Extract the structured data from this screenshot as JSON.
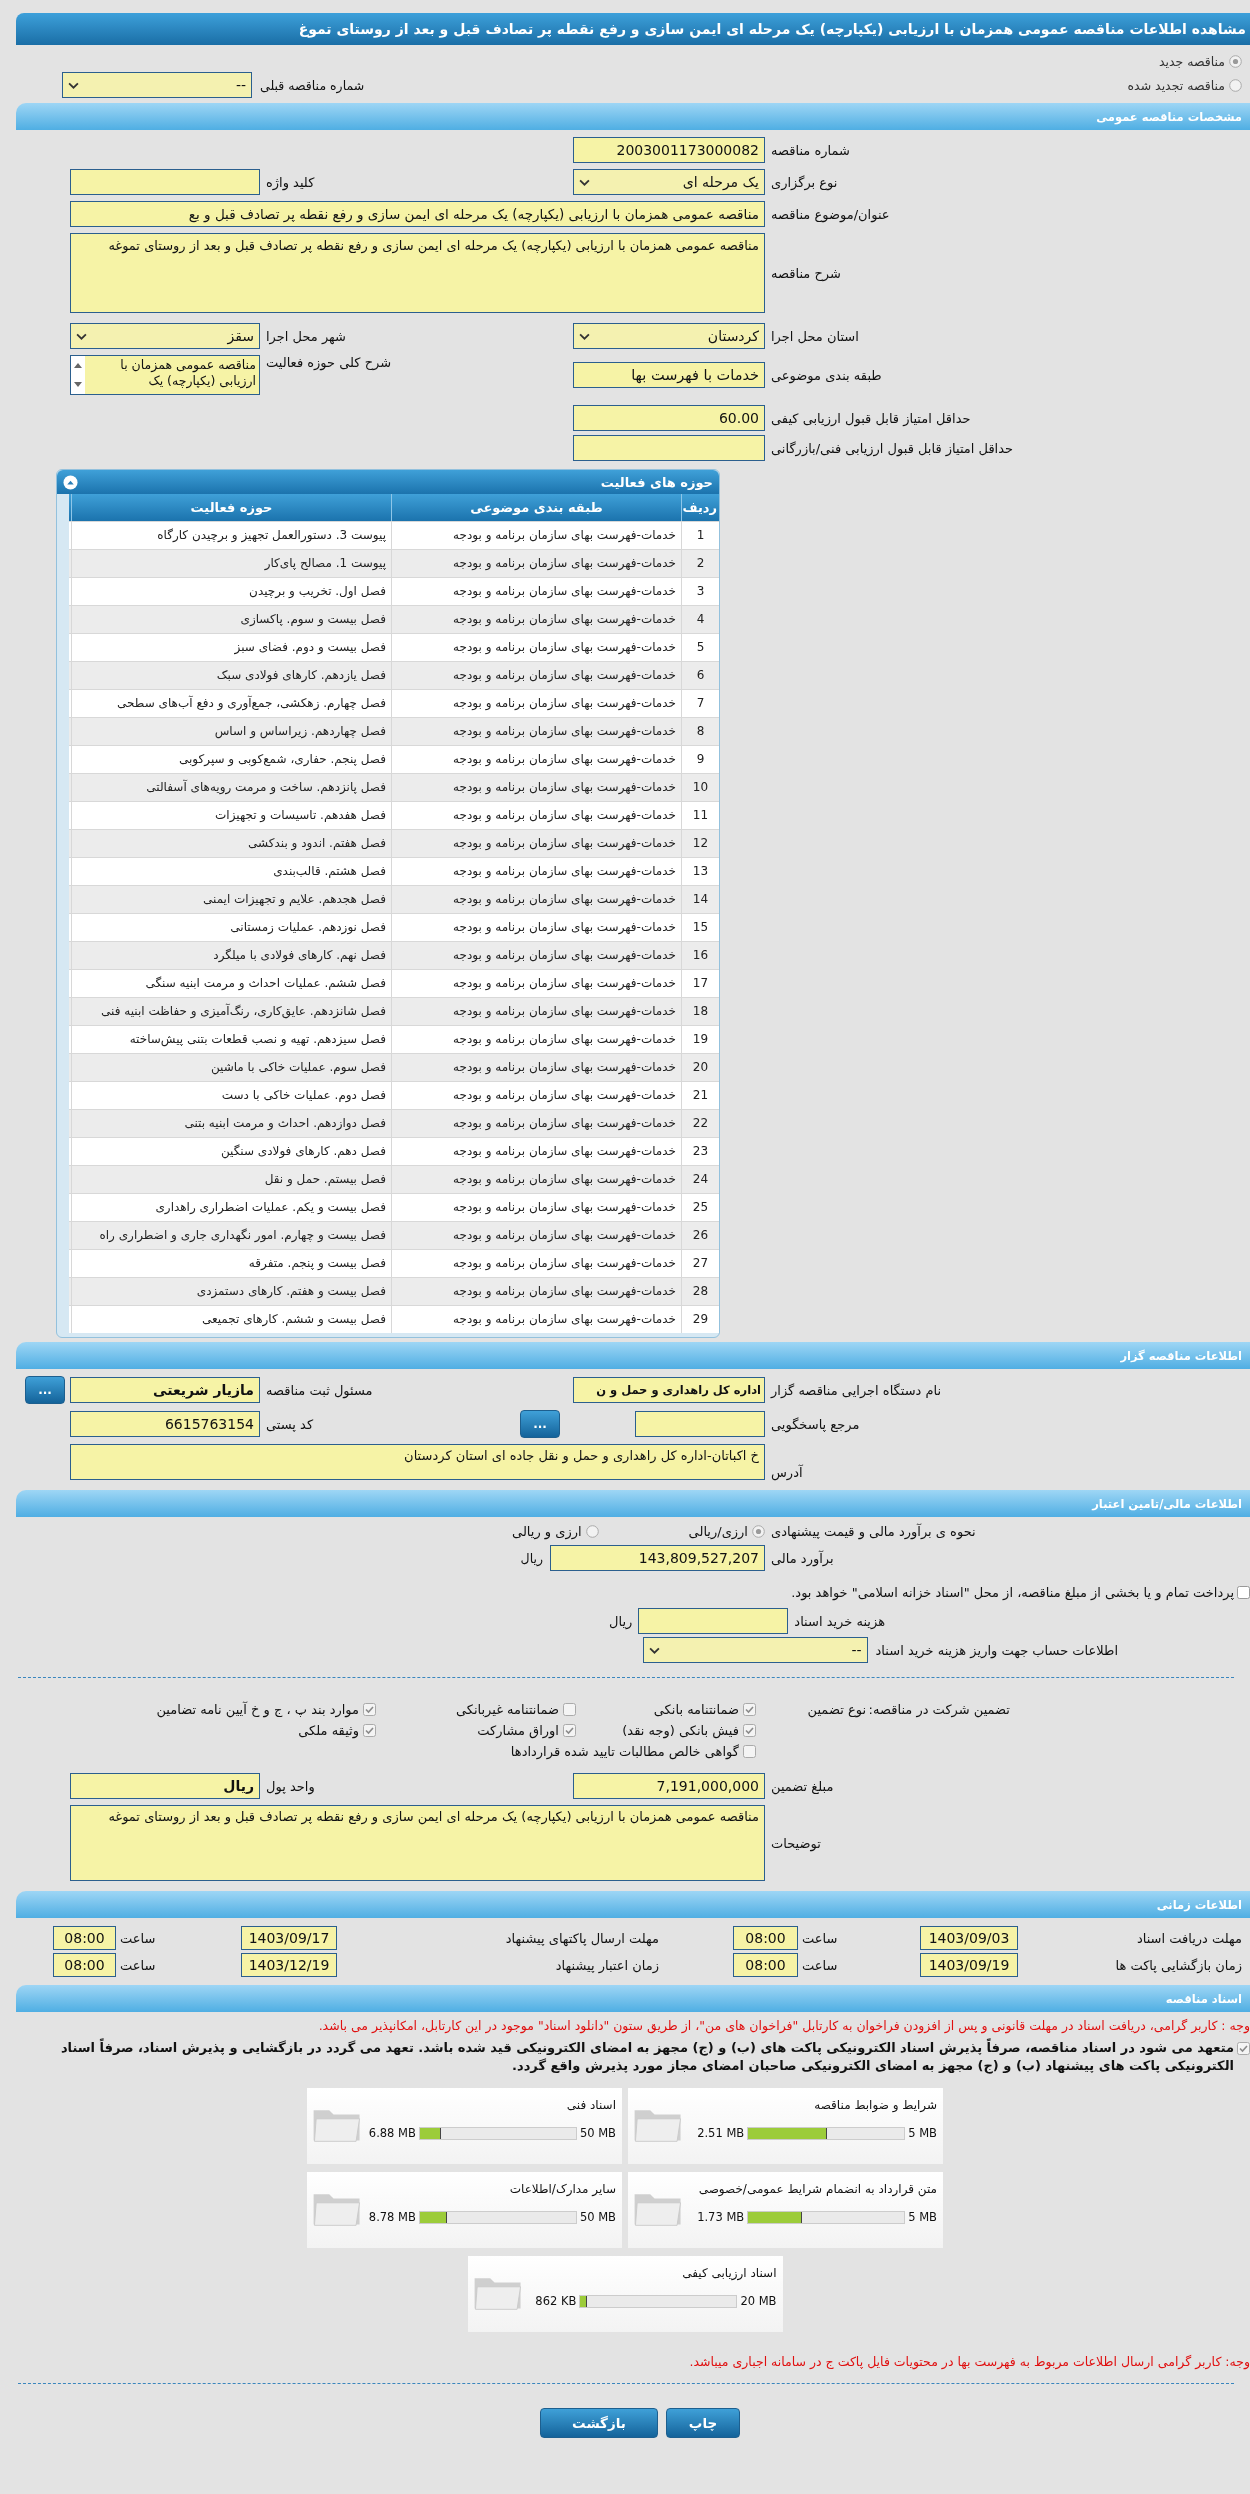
{
  "title": "مشاهده اطلاعات مناقصه عمومی همزمان با ارزیابی (یکپارچه) یک مرحله ای ایمن سازی و رفع نقطه پر تصادف قبل و بعد از روستای تموغ",
  "tender_kind": [
    {
      "label": "مناقصه جدید",
      "selected": true
    },
    {
      "label": "مناقصه تجدید شده",
      "selected": false
    }
  ],
  "previous_tender": {
    "label": "شماره مناقصه قبلی",
    "value": "--"
  },
  "general": {
    "header": "مشخصات مناقصه عمومی",
    "tender_number": {
      "label": "شماره مناقصه",
      "value": "2003001173000082"
    },
    "holding_type": {
      "label": "نوع برگزاری",
      "value": "یک مرحله ای"
    },
    "keyword": {
      "label": "کلید واژه"
    },
    "subject": {
      "label": "عنوان/موضوع مناقصه",
      "value": "مناقصه عمومی همزمان با ارزیابی (یکپارچه) یک مرحله ای  ایمن سازی و رفع نقطه پر تصادف قبل و بع"
    },
    "description": {
      "label": "شرح مناقصه",
      "value": "مناقصه عمومی همزمان با ارزیابی (یکپارچه) یک مرحله ای ایمن سازی و رفع نقطه پر تصادف قبل و بعد از روستای تموغه"
    },
    "province": {
      "label": "استان محل اجرا",
      "value": "کردستان"
    },
    "city": {
      "label": "شهر محل اجرا",
      "value": "سقز"
    },
    "classification": {
      "label": "طبقه بندی موضوعی",
      "value": "خدمات با فهرست بها"
    },
    "activity_summary": {
      "label": "شرح کلی حوزه فعالیت",
      "value": "مناقصه عمومی همزمان با ارزیابی (یکپارچه) یک"
    },
    "min_quality_score": {
      "label": "حداقل امتیاز قابل قبول ارزیابی کیفی",
      "value": "60.00"
    },
    "min_technical_score": {
      "label": "حداقل امتیاز قابل قبول ارزیابی فنی/بازرگانی"
    }
  },
  "activities": {
    "title": "حوزه های فعالیت",
    "columns": [
      "ردیف",
      "طبقه بندی موضوعی",
      "حوزه فعالیت"
    ],
    "rows": [
      {
        "no": "1",
        "category": "خدمات-فهرست بهای سازمان برنامه و بودجه",
        "activity": "پیوست 3. دستورالعمل تجهیز و برچیدن کارگاه"
      },
      {
        "no": "2",
        "category": "خدمات-فهرست بهای سازمان برنامه و بودجه",
        "activity": "پیوست 1. مصالح پای‌کار"
      },
      {
        "no": "3",
        "category": "خدمات-فهرست بهای سازمان برنامه و بودجه",
        "activity": "فصل اول. تخریب و برچیدن"
      },
      {
        "no": "4",
        "category": "خدمات-فهرست بهای سازمان برنامه و بودجه",
        "activity": "فصل بیست و سوم. پاکسازی"
      },
      {
        "no": "5",
        "category": "خدمات-فهرست بهای سازمان برنامه و بودجه",
        "activity": "فصل بیست و دوم. فضای سبز"
      },
      {
        "no": "6",
        "category": "خدمات-فهرست بهای سازمان برنامه و بودجه",
        "activity": "فصل یازدهم. کارهای فولادی سبک"
      },
      {
        "no": "7",
        "category": "خدمات-فهرست بهای سازمان برنامه و بودجه",
        "activity": "فصل چهارم. زهکشی، جمع‌آوری و دفع آب‌های سطحی"
      },
      {
        "no": "8",
        "category": "خدمات-فهرست بهای سازمان برنامه و بودجه",
        "activity": "فصل چهاردهم. زیراساس و اساس"
      },
      {
        "no": "9",
        "category": "خدمات-فهرست بهای سازمان برنامه و بودجه",
        "activity": "فصل پنجم. حفاری، شمع‌کوبی و سپرکوبی"
      },
      {
        "no": "10",
        "category": "خدمات-فهرست بهای سازمان برنامه و بودجه",
        "activity": "فصل پانزدهم. ساخت و مرمت رویه‌های آسفالتی"
      },
      {
        "no": "11",
        "category": "خدمات-فهرست بهای سازمان برنامه و بودجه",
        "activity": "فصل هفدهم. تاسیسات و تجهیزات"
      },
      {
        "no": "12",
        "category": "خدمات-فهرست بهای سازمان برنامه و بودجه",
        "activity": "فصل هفتم. اندود و بندکشی"
      },
      {
        "no": "13",
        "category": "خدمات-فهرست بهای سازمان برنامه و بودجه",
        "activity": "فصل هشتم. قالب‌بندی"
      },
      {
        "no": "14",
        "category": "خدمات-فهرست بهای سازمان برنامه و بودجه",
        "activity": "فصل هجدهم. علایم و تجهیزات ایمنی"
      },
      {
        "no": "15",
        "category": "خدمات-فهرست بهای سازمان برنامه و بودجه",
        "activity": "فصل نوزدهم. عملیات زمستانی"
      },
      {
        "no": "16",
        "category": "خدمات-فهرست بهای سازمان برنامه و بودجه",
        "activity": "فصل نهم. کارهای فولادی با میلگرد"
      },
      {
        "no": "17",
        "category": "خدمات-فهرست بهای سازمان برنامه و بودجه",
        "activity": "فصل ششم.  عملیات احداث و مرمت ابنیه سنگی"
      },
      {
        "no": "18",
        "category": "خدمات-فهرست بهای سازمان برنامه و بودجه",
        "activity": "فصل شانزدهم. عایق‌کاری، رنگ‌آمیزی و حفاظت ابنیه فنی"
      },
      {
        "no": "19",
        "category": "خدمات-فهرست بهای سازمان برنامه و بودجه",
        "activity": "فصل سیزدهم. تهیه و نصب قطعات بتنی پیش‌ساخته"
      },
      {
        "no": "20",
        "category": "خدمات-فهرست بهای سازمان برنامه و بودجه",
        "activity": "فصل سوم. عملیات خاکی با ماشین"
      },
      {
        "no": "21",
        "category": "خدمات-فهرست بهای سازمان برنامه و بودجه",
        "activity": "فصل دوم. عملیات خاکی با دست"
      },
      {
        "no": "22",
        "category": "خدمات-فهرست بهای سازمان برنامه و بودجه",
        "activity": "فصل دوازدهم. احداث و مرمت ابنیه بتنی"
      },
      {
        "no": "23",
        "category": "خدمات-فهرست بهای سازمان برنامه و بودجه",
        "activity": "فصل دهم. کارهای فولادی سنگین"
      },
      {
        "no": "24",
        "category": "خدمات-فهرست بهای سازمان برنامه و بودجه",
        "activity": "فصل بیستم. حمل و نقل"
      },
      {
        "no": "25",
        "category": "خدمات-فهرست بهای سازمان برنامه و بودجه",
        "activity": "فصل بیست و یکم. عملیات اضطراری راهداری"
      },
      {
        "no": "26",
        "category": "خدمات-فهرست بهای سازمان برنامه و بودجه",
        "activity": "فصل بیست و چهارم. امور نگهداری جاری و اضطراری راه"
      },
      {
        "no": "27",
        "category": "خدمات-فهرست بهای سازمان برنامه و بودجه",
        "activity": "فصل بیست و پنجم. متفرقه"
      },
      {
        "no": "28",
        "category": "خدمات-فهرست بهای سازمان برنامه و بودجه",
        "activity": "فصل بیست و هفتم. کارهای دستمزدی"
      },
      {
        "no": "29",
        "category": "خدمات-فهرست بهای سازمان برنامه و بودجه",
        "activity": "فصل بیست و ششم. کارهای تجمیعی"
      }
    ]
  },
  "organizer": {
    "header": "اطلاعات مناقصه گزار",
    "agency": {
      "label": "نام دستگاه اجرایی مناقصه گزار",
      "value": "اداره کل راهداری و حمل و ن"
    },
    "registrar": {
      "label": "مسئول ثبت مناقصه",
      "value": "مازیار شریعتی",
      "button": "..."
    },
    "reference": {
      "label": "مرجع پاسخگویی",
      "button": "..."
    },
    "postal_code": {
      "label": "کد پستی",
      "value": "6615763154"
    },
    "address": {
      "label": "آدرس",
      "value": "خ اکباتان-اداره کل راهداری و حمل و نقل جاده ای استان کردستان"
    }
  },
  "finance": {
    "header": "اطلاعات مالی/تامین اعتبار",
    "estimate_method": {
      "label": "نحوه ی برآورد مالی و قیمت پیشنهادی",
      "options": [
        {
          "label": "ارزی/ریالی",
          "selected": true
        },
        {
          "label": "ارزی و ریالی",
          "selected": false
        }
      ]
    },
    "estimate": {
      "label": "برآورد مالی",
      "value": "143,809,527,207",
      "unit": "ریال"
    },
    "treasury": {
      "label": "پرداخت تمام و یا بخشی از مبلغ مناقصه، از محل \"اسناد خزانه اسلامی\" خواهد بود.",
      "checked": false
    },
    "document_fee": {
      "label": "هزینه خرید اسناد",
      "unit": "ریال"
    },
    "fee_account": {
      "label": "اطلاعات حساب جهت واریز هزینه خرید اسناد",
      "value": "--"
    }
  },
  "guarantee": {
    "label": "تضمین شرکت در مناقصه:",
    "type_label": "نوع تضمین",
    "options": [
      {
        "label": "ضمانتنامه بانکی",
        "checked": true
      },
      {
        "label": "ضمانتنامه غیربانکی",
        "checked": false
      },
      {
        "label": "موارد بند پ ، ج و خ آیین نامه تضامین",
        "checked": true
      },
      {
        "label": "فیش بانکی (وجه نقد)",
        "checked": true
      },
      {
        "label": "اوراق مشارکت",
        "checked": true
      },
      {
        "label": "وثیقه ملکی",
        "checked": true
      },
      {
        "label": "گواهی خالص مطالبات تایید شده قراردادها",
        "checked": false
      }
    ],
    "amount": {
      "label": "مبلغ تضمین",
      "value": "7,191,000,000"
    },
    "currency": {
      "label": "واحد پول",
      "value": "ریال"
    },
    "notes": {
      "label": "توضیحات",
      "value": "مناقصه عمومی همزمان با ارزیابی (یکپارچه) یک مرحله ای ایمن سازی و رفع نقطه پر تصادف قبل و بعد از روستای تموغه"
    }
  },
  "timing": {
    "header": "اطلاعات زمانی",
    "items": [
      {
        "label": "مهلت دریافت اسناد",
        "date": "1403/09/03",
        "time_label": "ساعت",
        "time": "08:00"
      },
      {
        "label": "مهلت ارسال پاکتهای پیشنهاد",
        "date": "1403/09/17",
        "time_label": "ساعت",
        "time": "08:00"
      },
      {
        "label": "زمان بازگشایی پاکت ها",
        "date": "1403/09/19",
        "time_label": "ساعت",
        "time": "08:00"
      },
      {
        "label": "زمان اعتبار پیشنهاد",
        "date": "1403/12/19",
        "time_label": "ساعت",
        "time": "08:00"
      }
    ]
  },
  "documents": {
    "header": "اسناد مناقصه",
    "notice": "وجه : کاربر گرامی، دریافت اسناد در مهلت قانونی و پس از افزودن فراخوان به کارتابل \"فراخوان های من\"، از طریق ستون \"دانلود اسناد\" موجود در این کارتابل، امکانپذیر می باشد.",
    "commitment": {
      "text": "متعهد می شود در اسناد مناقصه، صرفاً پذیرش اسناد الکترونیکی پاکت های (ب) و (ج) مجهز به امضای الکترونیکی قید شده باشد. تعهد می گردد در بازگشایی و پذیرش اسناد، صرفاً اسناد الکترونیکی پاکت های پیشنهاد (ب) و (ج) مجهز به امضای الکترونیکی صاحبان امضای مجاز مورد پذیرش واقع گردد.",
      "checked": true
    },
    "files": [
      {
        "title": "شرایط و ضوابط مناقصه",
        "max": "5 MB",
        "used": "2.51 MB",
        "level": 0.502
      },
      {
        "title": "اسناد فنی",
        "max": "50 MB",
        "used": "6.88 MB",
        "level": 0.138
      },
      {
        "title": "متن قرارداد به انضمام شرایط عمومی/خصوصی",
        "max": "5 MB",
        "used": "1.73 MB",
        "level": 0.346
      },
      {
        "title": "سایر مدارک/اطلاعات",
        "max": "50 MB",
        "used": "8.78 MB",
        "level": 0.176
      },
      {
        "title": "اسناد ارزیابی کیفی",
        "max": "20 MB",
        "used": "862 KB",
        "level": 0.042
      }
    ],
    "notice_2": "وجه: کاربر گرامی ارسال اطلاعات مربوط به فهرست بها در محتویات فایل پاکت ج در سامانه اجباری میباشد."
  },
  "buttons": [
    "چاپ",
    "بازگشت"
  ]
}
